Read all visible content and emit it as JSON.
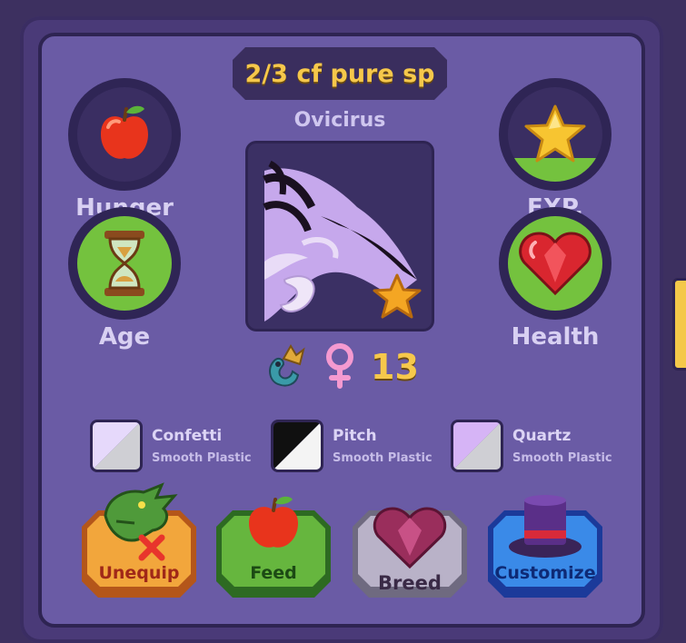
{
  "title": "2/3 cf pure sp",
  "pet": {
    "name": "Ovicirus",
    "level": "13",
    "gender_icon": "female-symbol-icon",
    "species_icon": "dragon-icon"
  },
  "stats": {
    "hunger": {
      "label": "Hunger",
      "icon": "apple-icon",
      "fill": 0.0
    },
    "exp": {
      "label": "EXP.",
      "icon": "star-icon",
      "fill": 0.25
    },
    "age": {
      "label": "Age",
      "icon": "hourglass-icon",
      "fill": 1.0
    },
    "health": {
      "label": "Health",
      "icon": "heart-icon",
      "fill": 1.0
    }
  },
  "materials": [
    {
      "name": "Confetti",
      "type": "Smooth Plastic",
      "color_a": "#e6d9fb",
      "color_b": "#cfcfd4"
    },
    {
      "name": "Pitch",
      "type": "Smooth Plastic",
      "color_a": "#101010",
      "color_b": "#f4f4f4"
    },
    {
      "name": "Quartz",
      "type": "Smooth Plastic",
      "color_a": "#d6b4f6",
      "color_b": "#cfcfd4"
    }
  ],
  "actions": {
    "unequip": "Unequip",
    "feed": "Feed",
    "breed": "Breed",
    "customize": "Customize"
  },
  "colors": {
    "accent": "#f6c84b",
    "panel": "#6a5ba5",
    "stat_fill": "#74c23e"
  }
}
